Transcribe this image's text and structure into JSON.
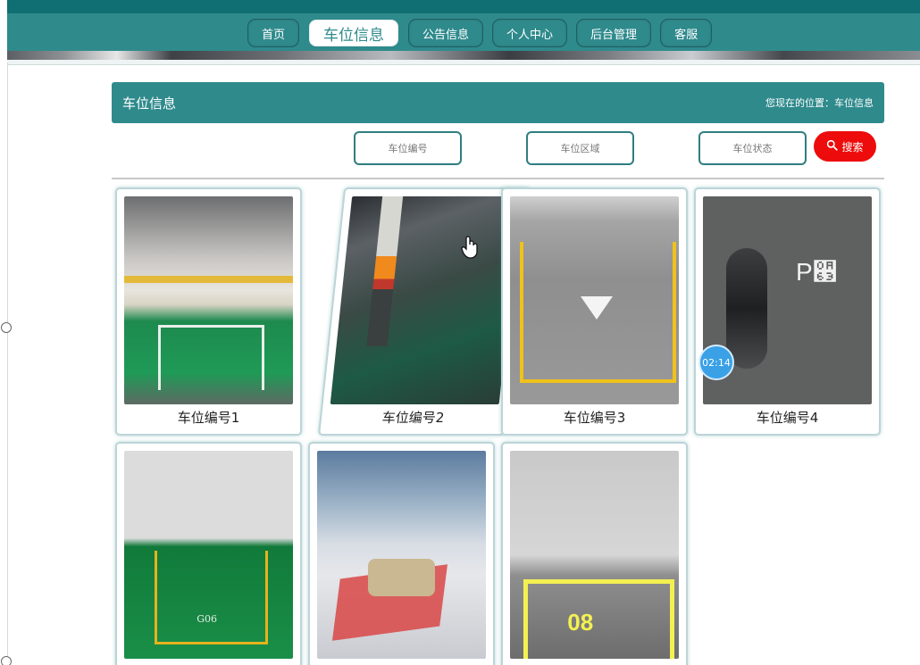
{
  "nav": {
    "items": [
      {
        "label": "首页",
        "active": false
      },
      {
        "label": "车位信息",
        "active": true
      },
      {
        "label": "公告信息",
        "active": false
      },
      {
        "label": "个人中心",
        "active": false
      },
      {
        "label": "后台管理",
        "active": false
      },
      {
        "label": "客服",
        "active": false
      }
    ]
  },
  "section": {
    "title": "车位信息",
    "breadcrumb": "您现在的位置：车位信息"
  },
  "search": {
    "field1_placeholder": "车位编号",
    "field2_placeholder": "车位区域",
    "field3_placeholder": "车位状态",
    "button_label": "搜索"
  },
  "cards": [
    {
      "caption": "车位编号1"
    },
    {
      "caption": "车位编号2"
    },
    {
      "caption": "车位编号3"
    },
    {
      "caption": "车位编号4"
    },
    {
      "caption": ""
    },
    {
      "caption": ""
    },
    {
      "caption": ""
    }
  ],
  "timer_badge": "02:14",
  "colors": {
    "primary": "#2f8a8c",
    "nav_dark": "#0f6f73",
    "search_button": "#ee0b0b"
  }
}
